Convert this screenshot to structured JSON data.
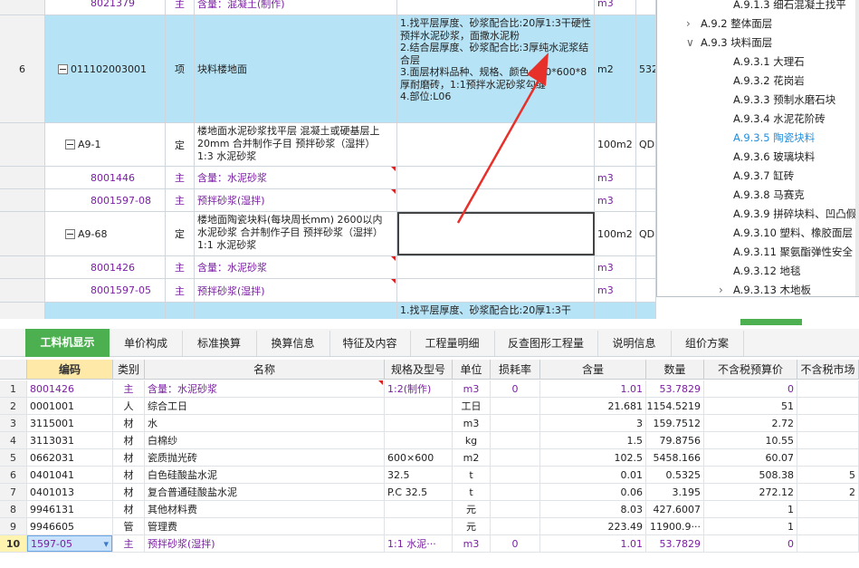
{
  "upper_rows": [
    {
      "num": "",
      "code": "8021379",
      "type": "主",
      "name": "含量：混凝土(制作)",
      "desc": "",
      "unit": "m3",
      "extra": "",
      "kind": "sub"
    },
    {
      "num": "6",
      "code": "011102003001",
      "type": "项",
      "name": "块料楼地面",
      "desc": "1.找平层厚度、砂浆配合比:20厚1:3干硬性预拌水泥砂浆，面撒水泥粉\n2.结合层厚度、砂浆配合比:3厚纯水泥浆结合层\n3.面层材料品种、规格、颜色:600*600*8厚耐磨砖，1:1预拌水泥砂浆勾缝\n4.部位:L06",
      "unit": "m2",
      "extra": "532",
      "kind": "item"
    },
    {
      "num": "",
      "code": "A9-1",
      "type": "定",
      "name": "楼地面水泥砂浆找平层 混凝土或硬基层上 20mm  合并制作子目 预拌砂浆（湿拌） 1:3 水泥砂浆",
      "desc": "",
      "unit": "100m2",
      "extra": "QDL",
      "kind": "quota"
    },
    {
      "num": "",
      "code": "8001446",
      "type": "主",
      "name": "含量：水泥砂浆",
      "desc": "",
      "unit": "m3",
      "extra": "",
      "kind": "sub"
    },
    {
      "num": "",
      "code": "8001597-08",
      "type": "主",
      "name": "预拌砂浆(湿拌)",
      "desc": "",
      "unit": "m3",
      "extra": "",
      "kind": "sub"
    },
    {
      "num": "",
      "code": "A9-68",
      "type": "定",
      "name": "楼地面陶瓷块料(每块周长mm) 2600以内 水泥砂浆  合并制作子目 预拌砂浆（湿拌） 1:1 水泥砂浆",
      "desc": "",
      "unit": "100m2",
      "extra": "QDL",
      "kind": "quota"
    },
    {
      "num": "",
      "code": "8001426",
      "type": "主",
      "name": "含量：水泥砂浆",
      "desc": "",
      "unit": "m3",
      "extra": "",
      "kind": "sub"
    },
    {
      "num": "",
      "code": "8001597-05",
      "type": "主",
      "name": "预拌砂浆(湿拌)",
      "desc": "",
      "unit": "m3",
      "extra": "",
      "kind": "sub"
    },
    {
      "num": "",
      "code": "",
      "type": "",
      "name": "",
      "desc": "1.找平层厚度、砂浆配合比:20厚1:3干",
      "unit": "",
      "extra": "",
      "kind": "item"
    }
  ],
  "tree": [
    {
      "label": "A.9.1.3 细石混凝土找平",
      "indent": 3,
      "chev": ""
    },
    {
      "label": "A.9.2 整体面层",
      "indent": 2,
      "chev": "right"
    },
    {
      "label": "A.9.3 块料面层",
      "indent": 2,
      "chev": "down"
    },
    {
      "label": "A.9.3.1 大理石",
      "indent": 3,
      "chev": ""
    },
    {
      "label": "A.9.3.2 花岗岩",
      "indent": 3,
      "chev": ""
    },
    {
      "label": "A.9.3.3 预制水磨石块",
      "indent": 3,
      "chev": ""
    },
    {
      "label": "A.9.3.4 水泥花阶砖",
      "indent": 3,
      "chev": ""
    },
    {
      "label": "A.9.3.5 陶瓷块料",
      "indent": 3,
      "chev": "",
      "active": true
    },
    {
      "label": "A.9.3.6 玻璃块料",
      "indent": 3,
      "chev": ""
    },
    {
      "label": "A.9.3.7 缸砖",
      "indent": 3,
      "chev": ""
    },
    {
      "label": "A.9.3.8 马赛克",
      "indent": 3,
      "chev": ""
    },
    {
      "label": "A.9.3.9 拼碎块料、凹凸假",
      "indent": 3,
      "chev": ""
    },
    {
      "label": "A.9.3.10 塑料、橡胶面层",
      "indent": 3,
      "chev": ""
    },
    {
      "label": "A.9.3.11 聚氨酯弹性安全",
      "indent": 3,
      "chev": ""
    },
    {
      "label": "A.9.3.12 地毯",
      "indent": 3,
      "chev": ""
    },
    {
      "label": "A.9.3.13 木地板",
      "indent": 3,
      "chev": "right"
    }
  ],
  "tabs": [
    "工料机显示",
    "单价构成",
    "标准换算",
    "换算信息",
    "特征及内容",
    "工程量明细",
    "反查图形工程量",
    "说明信息",
    "组价方案"
  ],
  "lower_headers": [
    "",
    "编码",
    "类别",
    "名称",
    "规格及型号",
    "单位",
    "损耗率",
    "含量",
    "数量",
    "不含税预算价",
    "不含税市场"
  ],
  "lower_rows": [
    {
      "n": "1",
      "code": "8001426",
      "cat": "主",
      "name": "含量：水泥砂浆",
      "spec": "1:2(制作)",
      "unit": "m3",
      "loss": "0",
      "qty": "1.01",
      "amount": "53.7829",
      "price": "0",
      "market": "",
      "purple": true
    },
    {
      "n": "2",
      "code": "0001001",
      "cat": "人",
      "name": "综合工日",
      "spec": "",
      "unit": "工日",
      "loss": "",
      "qty": "21.681",
      "amount": "1154.5219",
      "price": "51",
      "market": ""
    },
    {
      "n": "3",
      "code": "3115001",
      "cat": "材",
      "name": "水",
      "spec": "",
      "unit": "m3",
      "loss": "",
      "qty": "3",
      "amount": "159.7512",
      "price": "2.72",
      "market": ""
    },
    {
      "n": "4",
      "code": "3113031",
      "cat": "材",
      "name": "白棉纱",
      "spec": "",
      "unit": "kg",
      "loss": "",
      "qty": "1.5",
      "amount": "79.8756",
      "price": "10.55",
      "market": ""
    },
    {
      "n": "5",
      "code": "0662031",
      "cat": "材",
      "name": "瓷质抛光砖",
      "spec": "600×600",
      "unit": "m2",
      "loss": "",
      "qty": "102.5",
      "amount": "5458.166",
      "price": "60.07",
      "market": ""
    },
    {
      "n": "6",
      "code": "0401041",
      "cat": "材",
      "name": "白色硅酸盐水泥",
      "spec": "32.5",
      "unit": "t",
      "loss": "",
      "qty": "0.01",
      "amount": "0.5325",
      "price": "508.38",
      "market": "5"
    },
    {
      "n": "7",
      "code": "0401013",
      "cat": "材",
      "name": "复合普通硅酸盐水泥",
      "spec": "P.C 32.5",
      "unit": "t",
      "loss": "",
      "qty": "0.06",
      "amount": "3.195",
      "price": "272.12",
      "market": "2"
    },
    {
      "n": "8",
      "code": "9946131",
      "cat": "材",
      "name": "其他材料费",
      "spec": "",
      "unit": "元",
      "loss": "",
      "qty": "8.03",
      "amount": "427.6007",
      "price": "1",
      "market": ""
    },
    {
      "n": "9",
      "code": "9946605",
      "cat": "管",
      "name": "管理费",
      "spec": "",
      "unit": "元",
      "loss": "",
      "qty": "223.49",
      "amount": "11900.9···",
      "price": "1",
      "market": ""
    },
    {
      "n": "10",
      "code": "1597-05",
      "cat": "主",
      "name": "预拌砂浆(湿拌)",
      "spec": "1:1 水泥···",
      "unit": "m3",
      "loss": "0",
      "qty": "1.01",
      "amount": "53.7829",
      "price": "0",
      "market": "",
      "purple": true,
      "current": true
    }
  ],
  "colors": {
    "accent": "#4caf50",
    "selected_row": "#b6e3f5",
    "purple_text": "#7a1fa2",
    "annotation_arrow": "#e8302a"
  }
}
